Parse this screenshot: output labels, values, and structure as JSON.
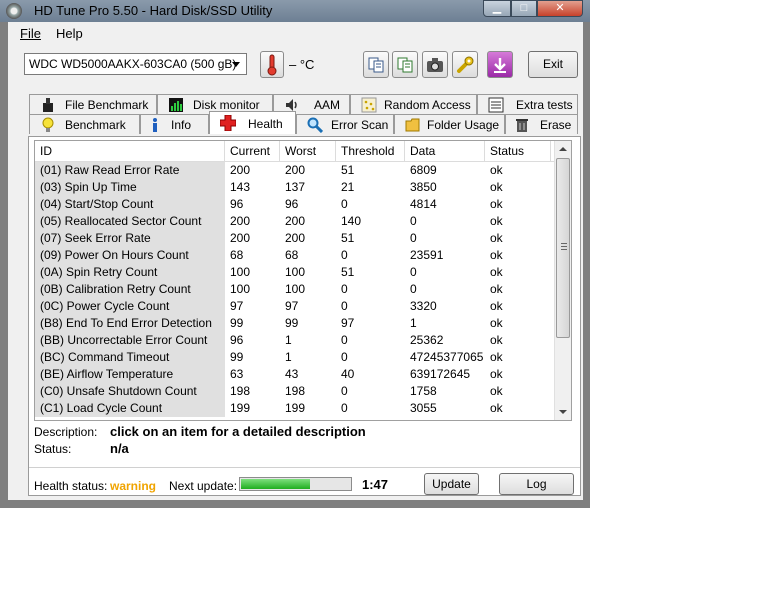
{
  "window": {
    "title": "HD Tune Pro 5.50 - Hard Disk/SSD Utility"
  },
  "menu": {
    "file": "File",
    "help": "Help"
  },
  "toolbar": {
    "drive": "WDC WD5000AAKX-603CA0 (500 gB)",
    "temperature": "– °C",
    "exit_label": "Exit"
  },
  "tabs_top": [
    {
      "label": "File Benchmark"
    },
    {
      "label": "Disk monitor"
    },
    {
      "label": "AAM"
    },
    {
      "label": "Random Access"
    },
    {
      "label": "Extra tests"
    }
  ],
  "tabs_bottom": [
    {
      "label": "Benchmark"
    },
    {
      "label": "Info"
    },
    {
      "label": "Health"
    },
    {
      "label": "Error Scan"
    },
    {
      "label": "Folder Usage"
    },
    {
      "label": "Erase"
    }
  ],
  "table": {
    "headers": [
      "ID",
      "Current",
      "Worst",
      "Threshold",
      "Data",
      "Status"
    ],
    "rows": [
      [
        "(01) Raw Read Error Rate",
        "200",
        "200",
        "51",
        "6809",
        "ok"
      ],
      [
        "(03) Spin Up Time",
        "143",
        "137",
        "21",
        "3850",
        "ok"
      ],
      [
        "(04) Start/Stop Count",
        "96",
        "96",
        "0",
        "4814",
        "ok"
      ],
      [
        "(05) Reallocated Sector Count",
        "200",
        "200",
        "140",
        "0",
        "ok"
      ],
      [
        "(07) Seek Error Rate",
        "200",
        "200",
        "51",
        "0",
        "ok"
      ],
      [
        "(09) Power On Hours Count",
        "68",
        "68",
        "0",
        "23591",
        "ok"
      ],
      [
        "(0A) Spin Retry Count",
        "100",
        "100",
        "51",
        "0",
        "ok"
      ],
      [
        "(0B) Calibration Retry Count",
        "100",
        "100",
        "0",
        "0",
        "ok"
      ],
      [
        "(0C) Power Cycle Count",
        "97",
        "97",
        "0",
        "3320",
        "ok"
      ],
      [
        "(B8) End To End Error Detection",
        "99",
        "99",
        "97",
        "1",
        "ok"
      ],
      [
        "(BB) Uncorrectable Error Count",
        "96",
        "1",
        "0",
        "25362",
        "ok"
      ],
      [
        "(BC) Command Timeout",
        "99",
        "1",
        "0",
        "47245377065",
        "ok"
      ],
      [
        "(BE) Airflow Temperature",
        "63",
        "43",
        "40",
        "639172645",
        "ok"
      ],
      [
        "(C0) Unsafe Shutdown Count",
        "198",
        "198",
        "0",
        "1758",
        "ok"
      ],
      [
        "(C1) Load Cycle Count",
        "199",
        "199",
        "0",
        "3055",
        "ok"
      ]
    ]
  },
  "description": {
    "label": "Description:",
    "value": "click on an item for a detailed description",
    "status_label": "Status:",
    "status_value": "n/a"
  },
  "footer": {
    "health_label": "Health status:",
    "health_value": "warning",
    "health_color": "#f0a400",
    "next_update_label": "Next update:",
    "next_update_progress": 0.63,
    "countdown": "1:47",
    "update_label": "Update",
    "log_label": "Log"
  }
}
